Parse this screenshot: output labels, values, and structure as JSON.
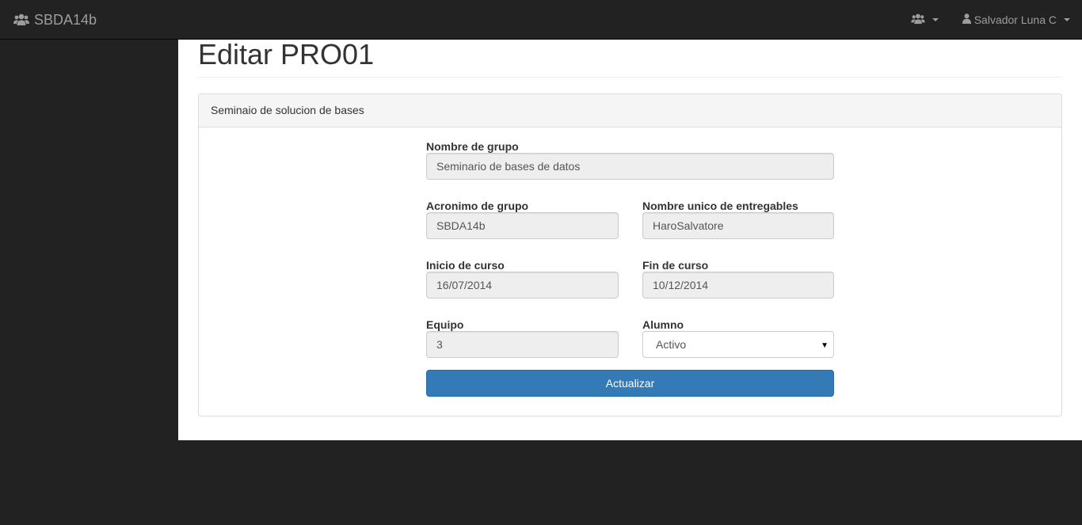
{
  "navbar": {
    "brand": "SBDA14b",
    "user_name": "Salvador Luna C"
  },
  "page": {
    "title": "Editar PRO01"
  },
  "panel": {
    "heading": "Seminaio de solucion de bases"
  },
  "form": {
    "nombre_grupo": {
      "label": "Nombre de grupo",
      "value": "Seminario de bases de datos"
    },
    "acronimo": {
      "label": "Acronimo de grupo",
      "value": "SBDA14b"
    },
    "nombre_entregables": {
      "label": "Nombre unico de entregables",
      "value": "HaroSalvatore"
    },
    "inicio": {
      "label": "Inicio de curso",
      "value": "16/07/2014"
    },
    "fin": {
      "label": "Fin de curso",
      "value": "10/12/2014"
    },
    "equipo": {
      "label": "Equipo",
      "value": "3"
    },
    "alumno": {
      "label": "Alumno",
      "selected": "Activo"
    },
    "submit_label": "Actualizar"
  },
  "icons": {
    "brand": "users-icon",
    "menu": "users-icon",
    "user": "user-icon"
  },
  "colors": {
    "navbar": "#222222",
    "primary": "#337ab7",
    "readonly_field": "#eeeeee"
  }
}
